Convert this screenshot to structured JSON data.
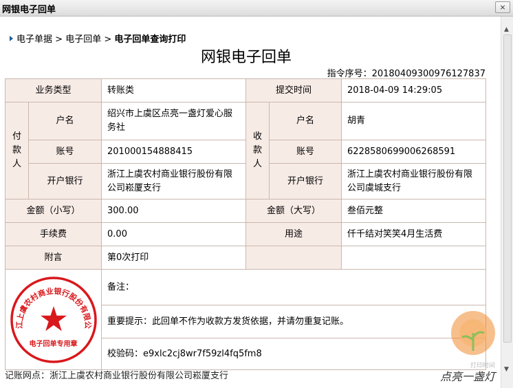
{
  "window": {
    "title": "网银电子回单",
    "close_label": "×"
  },
  "breadcrumb": {
    "items": [
      "电子单据",
      "电子回单"
    ],
    "separator": ">",
    "current": "电子回单查询打印"
  },
  "document": {
    "title": "网银电子回单",
    "serial_label": "指令序号：",
    "serial_value": "20180409300976127837"
  },
  "receipt": {
    "business_type_label": "业务类型",
    "business_type_value": "转账类",
    "submit_time_label": "提交时间",
    "submit_time_value": "2018-04-09 14:29:05",
    "payer_label": "付款人",
    "payee_label": "收款人",
    "name_label": "户名",
    "account_label": "账号",
    "bank_label": "开户银行",
    "payer_name": "绍兴市上虞区点亮一盏灯爱心服务社",
    "payer_account": "201000154888415",
    "payer_bank": "浙江上虞农村商业银行股份有限公司崧厦支行",
    "payee_name": "胡青",
    "payee_account": "6228580699006268591",
    "payee_bank": "浙江上虞农村商业银行股份有限公司虞城支行",
    "amount_small_label": "金额（小写）",
    "amount_small_value": "300.00",
    "amount_big_label": "金额（大写）",
    "amount_big_value": "叁佰元整",
    "fee_label": "手续费",
    "fee_value": "0.00",
    "purpose_label": "用途",
    "purpose_value": "仟千结对笑笑4月生活费",
    "postscript_label": "附言",
    "postscript_value": "第0次打印",
    "remark_label": "备注：",
    "notice": "重要提示：此回单不作为收款方发货依据，并请勿重复记账。",
    "verify_label": "校验码：",
    "verify_value": "e9xlc2cj8wr7f59zl4fq5fm8"
  },
  "seal": {
    "ring_text": "浙江上虞农村商业银行股份有限公司",
    "caption": "电子回单专用章",
    "color": "#d9181c"
  },
  "footer": {
    "text": "记账网点：浙江上虞农村商业银行股份有限公司崧厦支行"
  },
  "watermark": {
    "text": "点亮一盏灯",
    "faded_text": "打印时间",
    "color": "#f08a2e"
  },
  "scrollbar": {
    "up_icon": "▲",
    "down_icon": "▼"
  }
}
